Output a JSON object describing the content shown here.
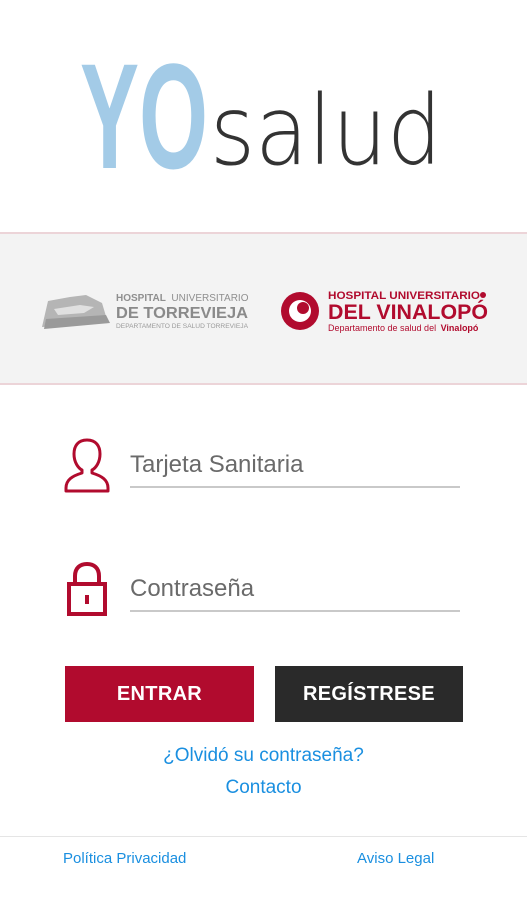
{
  "app": {
    "logo": {
      "yo": "YO",
      "salud": "salud",
      "yo_color": "#a3cbe7",
      "salud_color": "#333333"
    }
  },
  "hospitals": {
    "torrevieja": {
      "line1_a": "HOSPITAL",
      "line1_b": "UNIVERSITARIO",
      "line2": "DE TORREVIEJA",
      "line3": "DEPARTAMENTO DE SALUD TORREVIEJA",
      "color": "#9a9a9a"
    },
    "vinalopo": {
      "line1": "HOSPITAL UNIVERSITARIO",
      "line2": "DEL VINALOPÓ",
      "line3_a": "Departamento de salud del",
      "line3_b": "Vinalopó",
      "color": "#b10b2e"
    }
  },
  "form": {
    "card_placeholder": "Tarjeta Sanitaria",
    "password_placeholder": "Contraseña",
    "enter_label": "ENTRAR",
    "register_label": "REGÍSTRESE",
    "accent_color": "#b10b2e"
  },
  "links": {
    "forgot": "¿Olvidó su contraseña?",
    "contact": "Contacto"
  },
  "footer": {
    "privacy": "Política Privacidad",
    "legal": "Aviso Legal"
  }
}
